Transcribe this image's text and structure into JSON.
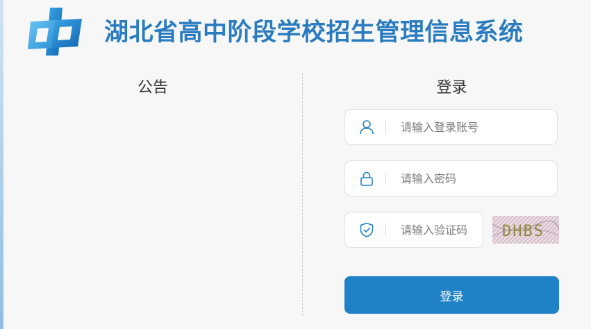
{
  "header": {
    "title": "湖北省高中阶段学校招生管理信息系统",
    "logo_icon": "zhong-logo-icon",
    "brand_color": "#2a7cc0"
  },
  "notice": {
    "title": "公告"
  },
  "login": {
    "title": "登录",
    "account": {
      "placeholder": "请输入登录账号",
      "value": "",
      "icon": "user-icon"
    },
    "password": {
      "placeholder": "请输入密码",
      "value": "",
      "icon": "lock-icon"
    },
    "captcha": {
      "placeholder": "请输入验证码",
      "value": "",
      "icon": "shield-check-icon",
      "image_text": "DHBS"
    },
    "submit_label": "登录",
    "accent_color": "#1f81c6"
  }
}
